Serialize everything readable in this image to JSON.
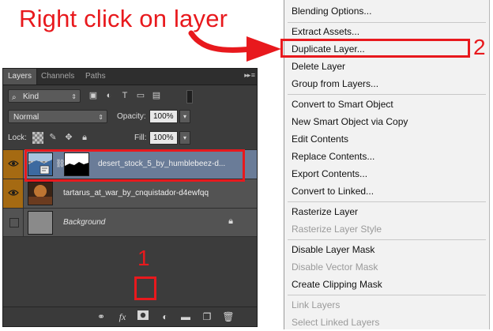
{
  "annotation": {
    "title": "Right click on layer",
    "step1": "1",
    "step2": "2",
    "color": "#e8191d"
  },
  "panel": {
    "tabs": [
      "Layers",
      "Channels",
      "Paths"
    ],
    "filter": {
      "kind_label": "Kind"
    },
    "blend_mode": "Normal",
    "opacity_label": "Opacity:",
    "opacity_value": "100%",
    "lock_label": "Lock:",
    "fill_label": "Fill:",
    "fill_value": "100%",
    "layers": [
      {
        "name": "desert_stock_5_by_humblebeez-d...",
        "visible": true,
        "selected": true
      },
      {
        "name": "tartarus_at_war_by_cnquistador-d4ewfqq",
        "visible": true,
        "selected": false
      },
      {
        "name": "Background",
        "visible": false,
        "selected": false,
        "locked": true
      }
    ],
    "selected_layer_color": "#6a7c98",
    "eye_column_color": "#a56a12"
  },
  "context_menu": {
    "items": [
      {
        "label": "Blending Options...",
        "enabled": true
      },
      {
        "label": "Extract Assets...",
        "enabled": true
      },
      {
        "label": "Duplicate Layer...",
        "enabled": true,
        "highlighted": true
      },
      {
        "label": "Delete Layer",
        "enabled": true
      },
      {
        "label": "Group from Layers...",
        "enabled": true
      },
      {
        "label": "Convert to Smart Object",
        "enabled": true
      },
      {
        "label": "New Smart Object via Copy",
        "enabled": true
      },
      {
        "label": "Edit Contents",
        "enabled": true
      },
      {
        "label": "Replace Contents...",
        "enabled": true
      },
      {
        "label": "Export Contents...",
        "enabled": true
      },
      {
        "label": "Convert to Linked...",
        "enabled": true
      },
      {
        "label": "Rasterize Layer",
        "enabled": true
      },
      {
        "label": "Rasterize Layer Style",
        "enabled": false
      },
      {
        "label": "Disable Layer Mask",
        "enabled": true
      },
      {
        "label": "Disable Vector Mask",
        "enabled": false
      },
      {
        "label": "Create Clipping Mask",
        "enabled": true
      },
      {
        "label": "Link Layers",
        "enabled": false
      },
      {
        "label": "Select Linked Layers",
        "enabled": false
      }
    ]
  },
  "icons": {
    "panel_menu": "collapse-menu-icon",
    "bottom": [
      "link-icon",
      "fx-icon",
      "add-mask-icon",
      "adjustment-icon",
      "group-folder-icon",
      "new-layer-icon",
      "trash-icon"
    ]
  }
}
